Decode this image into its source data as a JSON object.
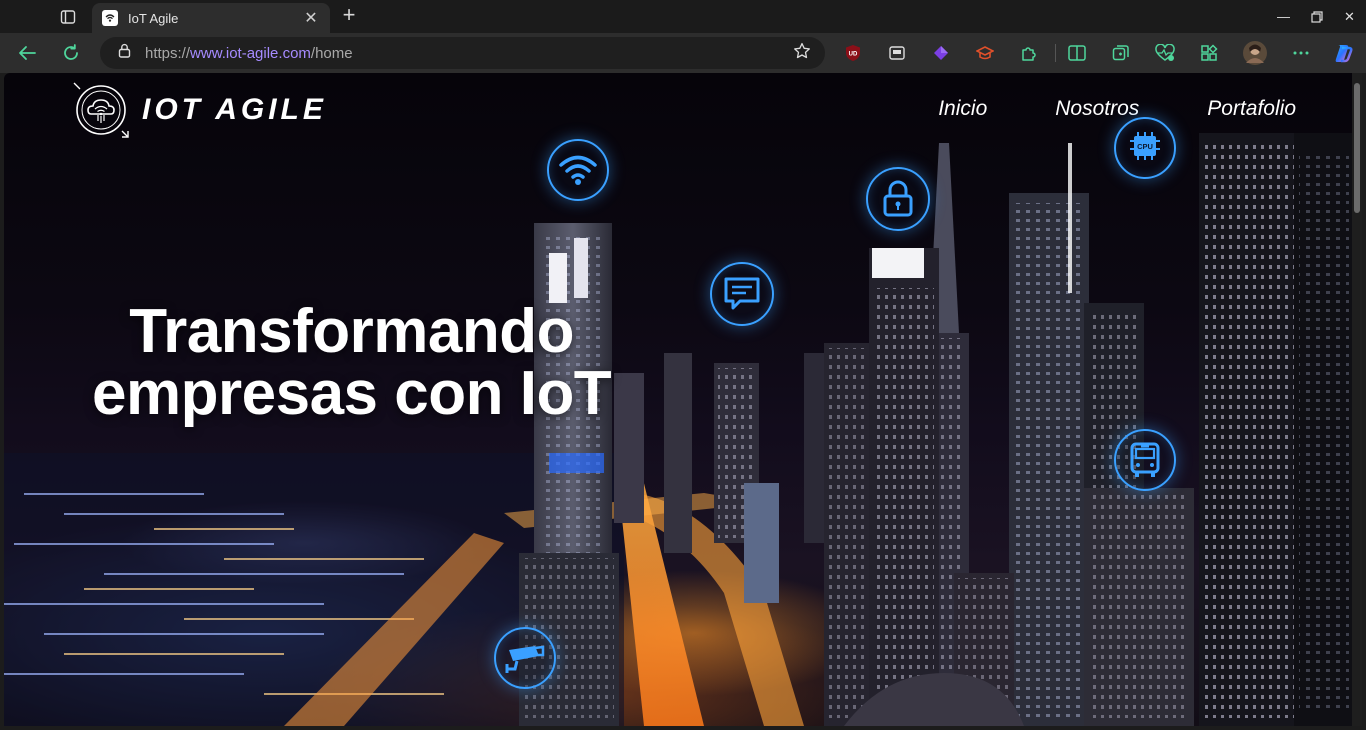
{
  "browser": {
    "tab": {
      "title": "IoT Agile",
      "favicon": "wifi-cloud-icon"
    },
    "url": {
      "proto": "https://",
      "host": "www.iot-agile.com",
      "path": "/home"
    },
    "window_controls": [
      "minimize",
      "restore",
      "close"
    ],
    "extensions": [
      "ublock-icon",
      "media-icon",
      "obsidian-icon",
      "academic-icon",
      "extensions-icon",
      "split-screen-icon",
      "collections-icon",
      "performance-icon",
      "apps-icon",
      "profile-avatar",
      "more-icon",
      "copilot-icon"
    ]
  },
  "site": {
    "logo_text": "IOT AGILE",
    "nav": [
      "Inicio",
      "Nosotros",
      "Portafolio"
    ],
    "hero_line1": "Transformando",
    "hero_line2": "empresas con IoT",
    "cpu_label": "CPU",
    "floating_icons": [
      "wifi-icon",
      "cpu-icon",
      "lock-icon",
      "message-icon",
      "bus-icon",
      "cctv-camera-icon"
    ]
  },
  "colors": {
    "accent": "#3aa0ff",
    "url_host": "#a68bff",
    "tab_bg": "#2d2d2d",
    "toolbar_bg": "#2d2d2d"
  }
}
